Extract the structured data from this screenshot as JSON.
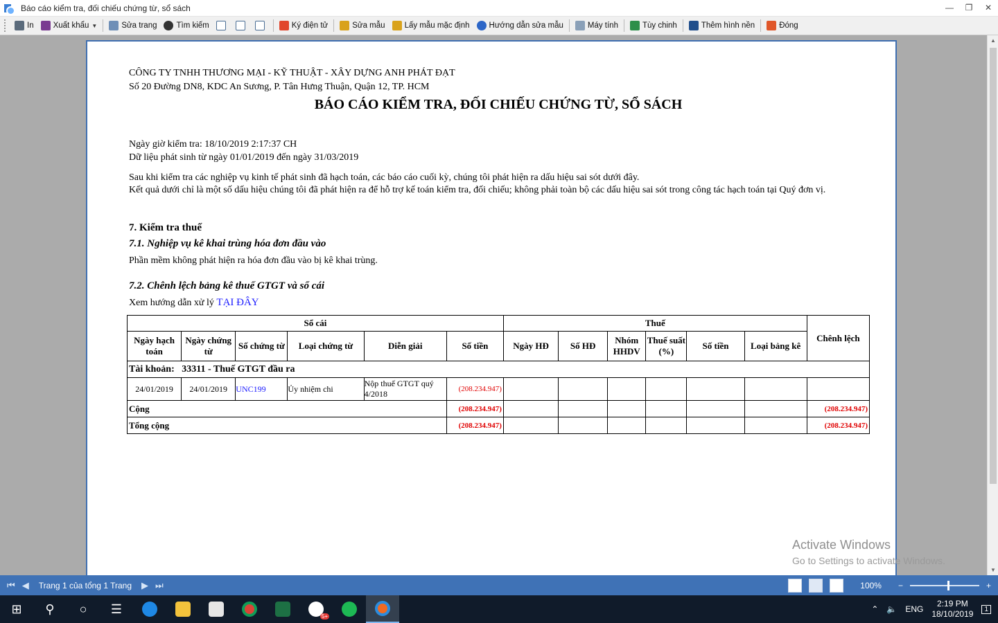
{
  "window": {
    "title": "Báo cáo kiểm tra, đối chiếu chứng từ, sổ sách"
  },
  "toolbar": {
    "print": "In",
    "export": "Xuất khẩu",
    "edit_page": "Sửa trang",
    "find": "Tìm kiếm",
    "e_sign": "Ký điện tử",
    "edit_template": "Sửa mẫu",
    "default_template": "Lấy mẫu mặc định",
    "template_help": "Hướng dẫn sửa mẫu",
    "calculator": "Máy tính",
    "customize": "Tùy chinh",
    "add_background": "Thêm hình nền",
    "close": "Đóng"
  },
  "report": {
    "company": "CÔNG TY TNHH THƯƠNG MẠI - KỸ THUẬT - XÂY DỰNG ANH PHÁT ĐẠT",
    "address": "Số 20 Đường DN8, KDC An Sương, P. Tân Hưng Thuận, Quận 12, TP. HCM",
    "title": "BÁO CÁO KIỂM TRA, ĐỐI CHIẾU CHỨNG TỪ, SỔ SÁCH",
    "check_time": "Ngày giờ kiểm tra: 18/10/2019 2:17:37 CH",
    "data_range": "Dữ liệu phát sinh từ ngày 01/01/2019 đến ngày 31/03/2019",
    "intro_1": "Sau khi kiểm tra các nghiệp vụ kinh tế phát sinh đã hạch toán, các báo cáo cuối kỳ, chúng tôi phát hiện ra dấu hiệu sai sót dưới đây.",
    "intro_2": "Kết quả dưới chỉ là một số dấu hiệu chúng tôi đã phát hiện ra để hỗ trợ kế toán kiểm tra, đối chiếu; không phải toàn bộ các dấu hiệu sai sót trong công tác hạch toán tại Quý đơn vị.",
    "section_7": "7. Kiểm tra thuế",
    "section_7_1": "7.1. Nghiệp vụ kê khai trùng hóa đơn đầu vào",
    "section_7_1_text": "Phần mềm không phát hiện ra hóa đơn đầu vào bị kê khai trùng.",
    "section_7_2": "7.2. Chênh lệch bảng kê thuế GTGT và sổ cái",
    "guide_text": "Xem hướng dẫn xử lý",
    "guide_link": "TẠI ĐÂY",
    "table": {
      "group_ledger": "Sổ cái",
      "group_tax": "Thuế",
      "col_diff": "Chênh lệch",
      "headers": {
        "post_date": "Ngày hạch toán",
        "doc_date": "Ngày chứng từ",
        "doc_no": "Số chứng từ",
        "doc_type": "Loại chứng từ",
        "description": "Diễn giải",
        "amount": "Số tiền",
        "inv_date": "Ngày HĐ",
        "inv_no": "Số HĐ",
        "group": "Nhóm HHDV",
        "rate": "Thuế suất (%)",
        "tax_amount": "Số tiền",
        "list_type": "Loại bảng kê"
      },
      "account_label": "Tài khoản:",
      "account_value": "33311 - Thuế GTGT đầu ra",
      "rows": [
        {
          "post_date": "24/01/2019",
          "doc_date": "24/01/2019",
          "doc_no": "UNC199",
          "doc_type": "Ủy nhiệm chi",
          "description": "Nộp thuế GTGT quý 4/2018",
          "amount": "(208.234.947)"
        }
      ],
      "subtotal_label": "Cộng",
      "subtotal_amount": "(208.234.947)",
      "subtotal_diff": "(208.234.947)",
      "total_label": "Tổng cộng",
      "total_amount": "(208.234.947)",
      "total_diff": "(208.234.947)"
    }
  },
  "watermark": {
    "line1": "Activate Windows",
    "line2": "Go to Settings to activate Windows."
  },
  "statusbar": {
    "page_info": "Trang 1 của tổng 1 Trang",
    "zoom": "100%"
  },
  "taskbar": {
    "lang": "ENG",
    "time": "2:19 PM",
    "date": "18/10/2019",
    "notif_count": "1",
    "zalo_badge": "5+"
  },
  "colors": {
    "status_blue": "#3f72b6",
    "negative_red": "#e00000",
    "link_blue": "#1a1aff",
    "page_border": "#3f6fb1"
  }
}
